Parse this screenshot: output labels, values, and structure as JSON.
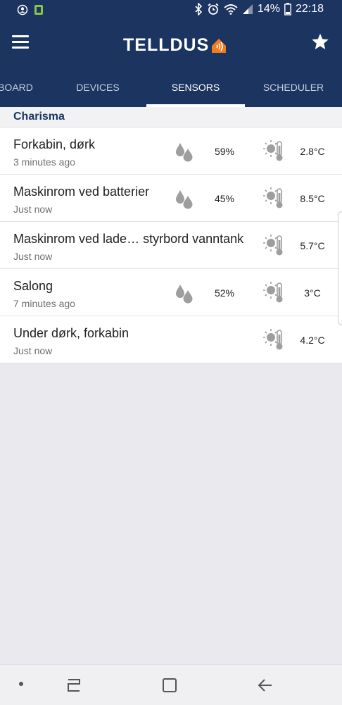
{
  "status_bar": {
    "battery": "14%",
    "time": "22:18",
    "icons": [
      "account-icon",
      "notification-icon",
      "bluetooth-icon",
      "alarm-icon",
      "wifi-icon",
      "signal-icon",
      "battery-icon"
    ]
  },
  "app_bar": {
    "logo_text": "TELLDUS",
    "menu_icon": "menu-icon",
    "favorite_icon": "star-icon",
    "logo_icon": "house-signal-icon"
  },
  "tabs": [
    {
      "label": "BOARD",
      "active": false
    },
    {
      "label": "DEVICES",
      "active": false
    },
    {
      "label": "SENSORS",
      "active": true
    },
    {
      "label": "SCHEDULER",
      "active": false
    }
  ],
  "group": {
    "title": "Charisma"
  },
  "sensors": [
    {
      "name": "Forkabin, dørk",
      "time": "3 minutes ago",
      "humidity": "59%",
      "temperature": "2.8°C"
    },
    {
      "name": "Maskinrom ved batterier",
      "time": "Just now",
      "humidity": "45%",
      "temperature": "8.5°C"
    },
    {
      "name": "Maskinrom ved lade… styrbord vanntank",
      "time": "Just now",
      "humidity": null,
      "temperature": "5.7°C"
    },
    {
      "name": "Salong",
      "time": "7 minutes ago",
      "humidity": "52%",
      "temperature": "3°C"
    },
    {
      "name": "Under dørk, forkabin",
      "time": "Just now",
      "humidity": null,
      "temperature": "4.2°C"
    }
  ],
  "colors": {
    "primary": "#1b3460",
    "accent": "#f07d22",
    "icon_gray": "#9e9e9e",
    "background": "#e9e9ee"
  },
  "nav_bar": {
    "icons": [
      "dot-icon",
      "recent-apps-icon",
      "home-icon",
      "back-icon"
    ]
  }
}
